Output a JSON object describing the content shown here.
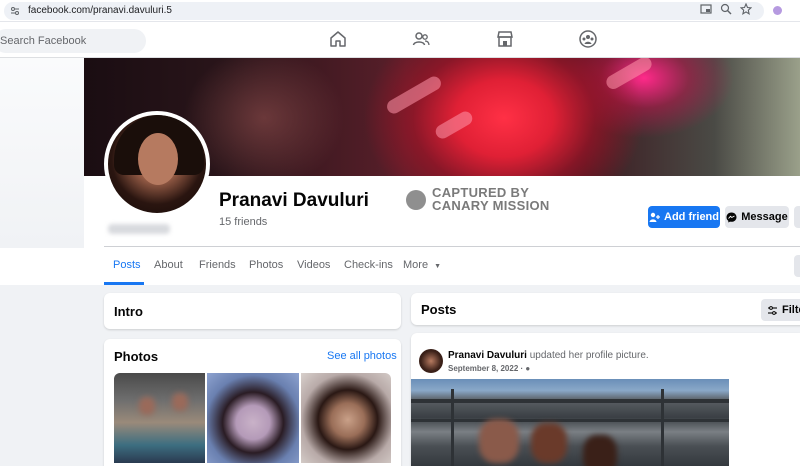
{
  "browser": {
    "url": "facebook.com/pranavi.davuluri.5"
  },
  "nav": {
    "search_placeholder": "Search Facebook",
    "icons": [
      "home-icon",
      "friends-icon",
      "marketplace-icon",
      "groups-icon"
    ]
  },
  "profile": {
    "name": "Pranavi Davuluri",
    "friends": "15 friends",
    "watermark_line1": "CAPTURED BY",
    "watermark_line2": "CANARY MISSION",
    "add_friend_label": "Add friend",
    "message_label": "Message"
  },
  "tabs": [
    "Posts",
    "About",
    "Friends",
    "Photos",
    "Videos",
    "Check-ins",
    "More"
  ],
  "intro": {
    "title": "Intro"
  },
  "photos": {
    "title": "Photos",
    "see_all": "See all photos"
  },
  "posts": {
    "title": "Posts",
    "filter_label": "Filter",
    "post": {
      "author": "Pranavi Davuluri",
      "action": "updated her profile picture.",
      "date": "September 8, 2022 ·"
    }
  },
  "colors": {
    "accent": "#1877f2",
    "background": "#f0f2f5"
  }
}
